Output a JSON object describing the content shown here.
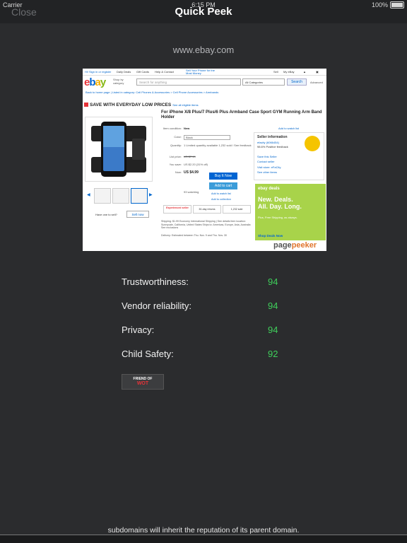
{
  "status": {
    "carrier": "Carrier",
    "time": "6:15 PM",
    "battery": "100%"
  },
  "nav": {
    "close_label": "Close",
    "title": "Quick Peek"
  },
  "site": {
    "domain": "www.ebay.com"
  },
  "preview": {
    "signin": "Hi! Sign in or register",
    "top_links": [
      "Daily Deals",
      "Gift Cards",
      "Help & Contact"
    ],
    "sell_promo": "Sell Your Phone for the Most Money",
    "top_right": [
      "Sell",
      "My eBay"
    ],
    "logo": {
      "e": "e",
      "b": "b",
      "a": "a",
      "y": "y"
    },
    "shop_by": "Shop by category",
    "search_placeholder": "Search for anything",
    "category": "All Categories",
    "search_button": "Search",
    "advanced": "Advanced",
    "breadcrumb": "Back to home page | Listed in category: Cell Phones & Accessories > Cell Phone Accessories > Armbands",
    "promo_text": "SAVE WITH EVERYDAY LOW PRICES",
    "promo_link": "See all eligible items",
    "item_title": "For iPhone X/8 Plus/7 Plus/6 Plus Armband Case Sport GYM Running Arm Band Holder",
    "share": "Add to watch list",
    "details": [
      {
        "k": "Item condition:",
        "v": "New"
      },
      {
        "k": "Color:",
        "v": "Black"
      },
      {
        "k": "Quantity:",
        "v": "1    Limited quantity available  1,232 sold / See feedback"
      },
      {
        "k": "List price:",
        "v": "US $7.19"
      },
      {
        "k": "You save:",
        "v": "US $2.20 (31% off)"
      },
      {
        "k": "Now:",
        "v": "US $4.99"
      }
    ],
    "buy_now": "Buy It Now",
    "add_cart": "Add to cart",
    "watching": "93 watching",
    "watch_list": "Add to watch list",
    "collection": "Add to collection",
    "tags": [
      "Experienced seller",
      "30-day returns",
      "1,232 sold"
    ],
    "seller": {
      "heading": "Seller information",
      "name": "efacity (6066454)",
      "feedback": "98.6% Positive feedback",
      "save": "Save this Seller",
      "contact": "Contact seller",
      "store": "Visit store: eFaCity",
      "other": "See other items"
    },
    "deals": {
      "heading": "ebay deals",
      "big_line_1": "New. Deals.",
      "big_line_2": "All. Day. Long.",
      "small": "Plus, Free Shipping, as always.",
      "shop": "Shop Deals Now"
    },
    "shipping": "Shipping: $1.99 Economy International Shipping | See details  Item location: Sunnyvale, California, United States  Ships to: Americas, Europe, Asia, Australia  See exclusions",
    "delivery": "Delivery: Estimated between Thu. Nov. 9 and Thu. Nov. 30",
    "have_one": "Have one to sell?",
    "sell_now": "Sell now",
    "watermark_a": "page",
    "watermark_b": "peeker"
  },
  "ratings": [
    {
      "label": "Trustworthiness:",
      "value": "94"
    },
    {
      "label": "Vendor reliability:",
      "value": "94"
    },
    {
      "label": "Privacy:",
      "value": "94"
    },
    {
      "label": "Child Safety:",
      "value": "92"
    }
  ],
  "badge": {
    "top": "FRIEND OF",
    "bottom": "WOT"
  },
  "footer": {
    "text": "subdomains will inherit the reputation of its parent domain."
  },
  "colors": {
    "background": "#2b2c2e",
    "rating_value": "#3fcf5b",
    "navbar": "#222325"
  }
}
